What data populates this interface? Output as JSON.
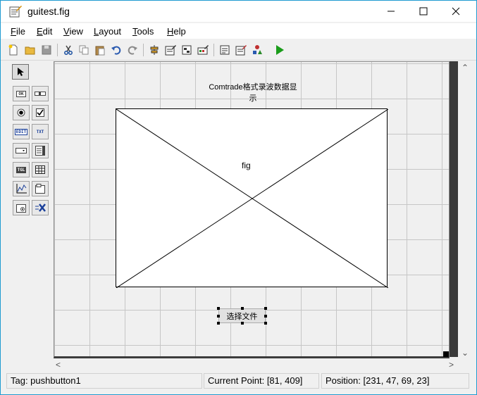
{
  "window": {
    "title": "guitest.fig",
    "minimize": "—",
    "maximize": "☐",
    "close": "✕"
  },
  "menu": {
    "items": [
      {
        "first": "F",
        "rest": "ile"
      },
      {
        "first": "E",
        "rest": "dit"
      },
      {
        "first": "V",
        "rest": "iew"
      },
      {
        "first": "L",
        "rest": "ayout"
      },
      {
        "first": "T",
        "rest": "ools"
      },
      {
        "first": "H",
        "rest": "elp"
      }
    ]
  },
  "toolbar": {
    "icons": [
      "new-file-icon",
      "open-folder-icon",
      "save-icon",
      "cut-icon",
      "copy-icon",
      "paste-icon",
      "undo-icon",
      "redo-icon",
      "align-icon",
      "menu-editor-icon",
      "tab-order-icon",
      "toolbar-editor-icon",
      "mfile-editor-icon",
      "property-inspector-icon",
      "object-browser-icon",
      "run-icon"
    ]
  },
  "palette": {
    "items": [
      "select-arrow-icon",
      "pushbutton-icon",
      "slider-icon",
      "radio-button-icon",
      "checkbox-icon",
      "edit-text-icon",
      "static-text-icon",
      "popup-menu-icon",
      "listbox-icon",
      "toggle-button-icon",
      "table-icon",
      "axes-icon",
      "panel-icon",
      "button-group-icon",
      "activex-icon"
    ],
    "labels": {
      "ok": "OK",
      "edit": "EDIT",
      "txt": "TXT",
      "tgl": "TGL"
    }
  },
  "canvas": {
    "static_text": "Comtrade格式录波数据显示",
    "axes_label": "fig",
    "pushbutton_label": "选择文件"
  },
  "scroll": {
    "up": "⌃",
    "down": "⌄",
    "left": "<",
    "right": ">"
  },
  "status": {
    "tag": "Tag: pushbutton1",
    "current_point": "Current Point:  [81, 409]",
    "position": "Position: [231, 47, 69, 23]"
  },
  "colors": {
    "accent": "#1f9bd1",
    "run_green": "#1a9c1a",
    "grid": "#c6c6c6"
  }
}
